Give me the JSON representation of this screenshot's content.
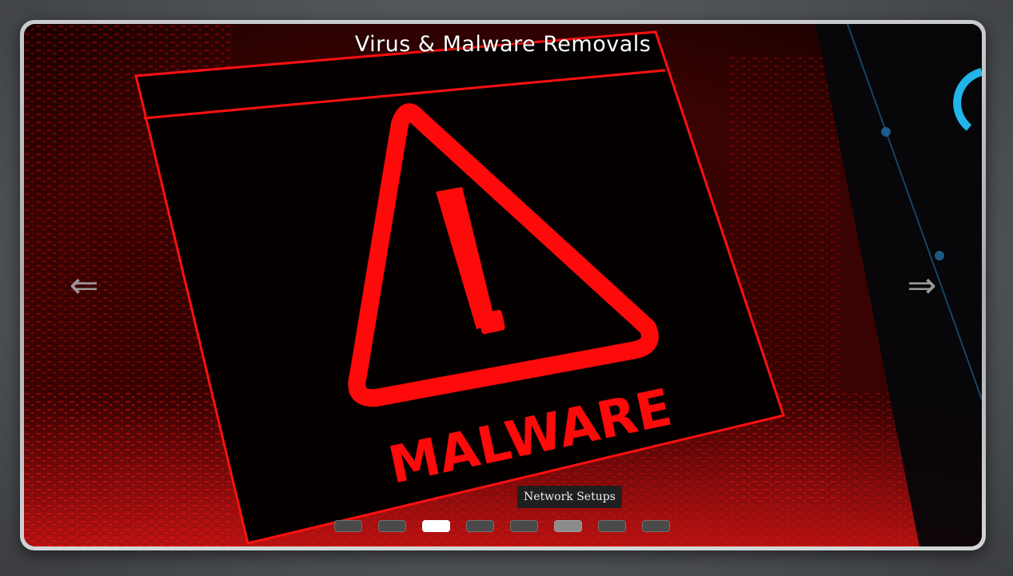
{
  "carousel": {
    "title": "Virus & Malware Removals",
    "image_text": "MALWARE",
    "prev_arrow": "⇐",
    "next_arrow": "⇒",
    "tooltip": "Network Setups",
    "active_index": 2,
    "hover_index": 5,
    "slide_count": 8
  },
  "colors": {
    "accent_red": "#ff0a0a",
    "background_gray": "#55585c",
    "frame_silver": "#c9cbcd"
  }
}
